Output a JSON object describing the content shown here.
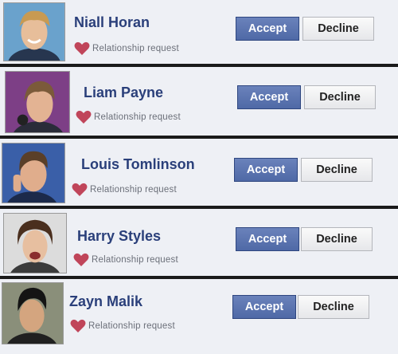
{
  "requests": [
    {
      "name": "Niall Horan",
      "request_label": "Relationship request",
      "accept_label": "Accept",
      "decline_label": "Decline"
    },
    {
      "name": "Liam Payne",
      "request_label": "Relationship request",
      "accept_label": "Accept",
      "decline_label": "Decline"
    },
    {
      "name": "Louis Tomlinson",
      "request_label": "Relationship request",
      "accept_label": "Accept",
      "decline_label": "Decline"
    },
    {
      "name": "Harry Styles",
      "request_label": "Relationship request",
      "accept_label": "Accept",
      "decline_label": "Decline"
    },
    {
      "name": "Zayn Malik",
      "request_label": "Relationship request",
      "accept_label": "Accept",
      "decline_label": "Decline"
    }
  ],
  "colors": {
    "accept_bg": "#4f69a6",
    "name_text": "#2a3f7a",
    "heart": "#c0455a",
    "row_bg": "#eef0f5"
  },
  "icons": {
    "request": "heart-icon"
  }
}
